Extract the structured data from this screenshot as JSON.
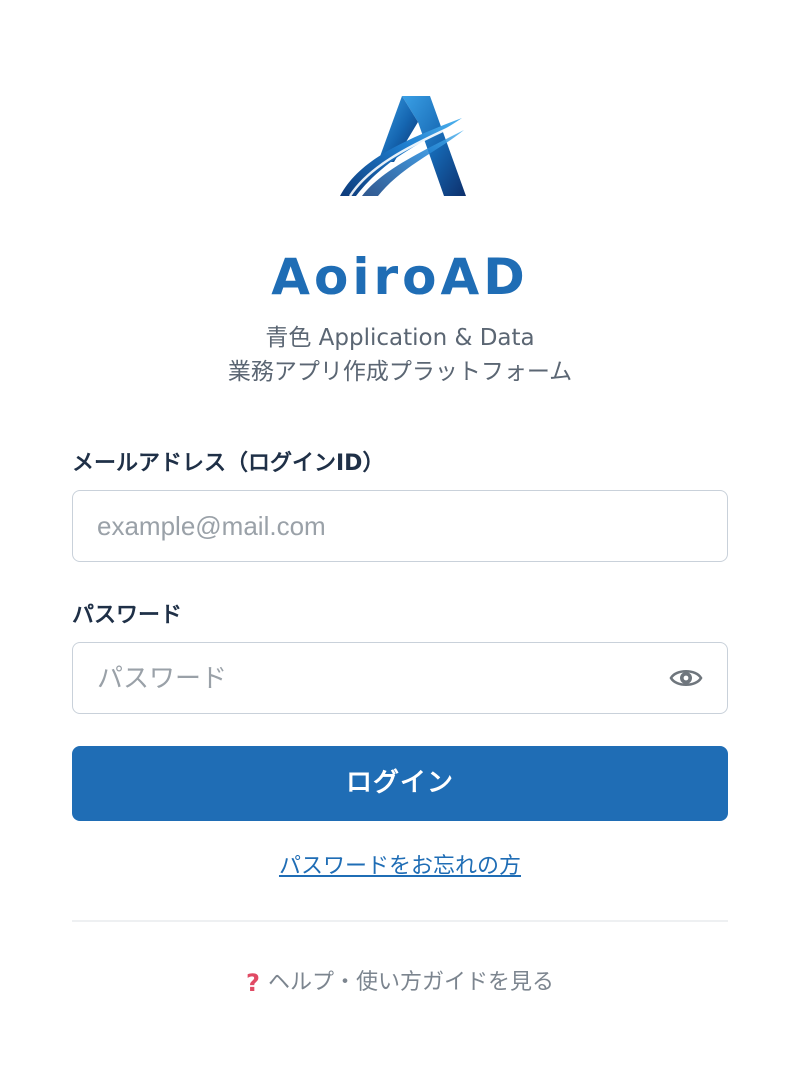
{
  "brand": {
    "name": "AoiroAD",
    "subtitle_line1": "青色 Application & Data",
    "subtitle_line2": "業務アプリ作成プラットフォーム",
    "logo_icon": "aoiro-a-logo-icon",
    "accent_color": "#1f6db5"
  },
  "form": {
    "email_label": "メールアドレス（ログインID）",
    "email_placeholder": "example@mail.com",
    "email_value": "",
    "password_label": "パスワード",
    "password_placeholder": "パスワード",
    "password_value": "",
    "password_toggle_icon": "eye-icon",
    "login_button": "ログイン"
  },
  "links": {
    "forgot_password": "パスワードをお忘れの方",
    "help_icon": "question-icon",
    "help": "ヘルプ・使い方ガイドを見る"
  }
}
